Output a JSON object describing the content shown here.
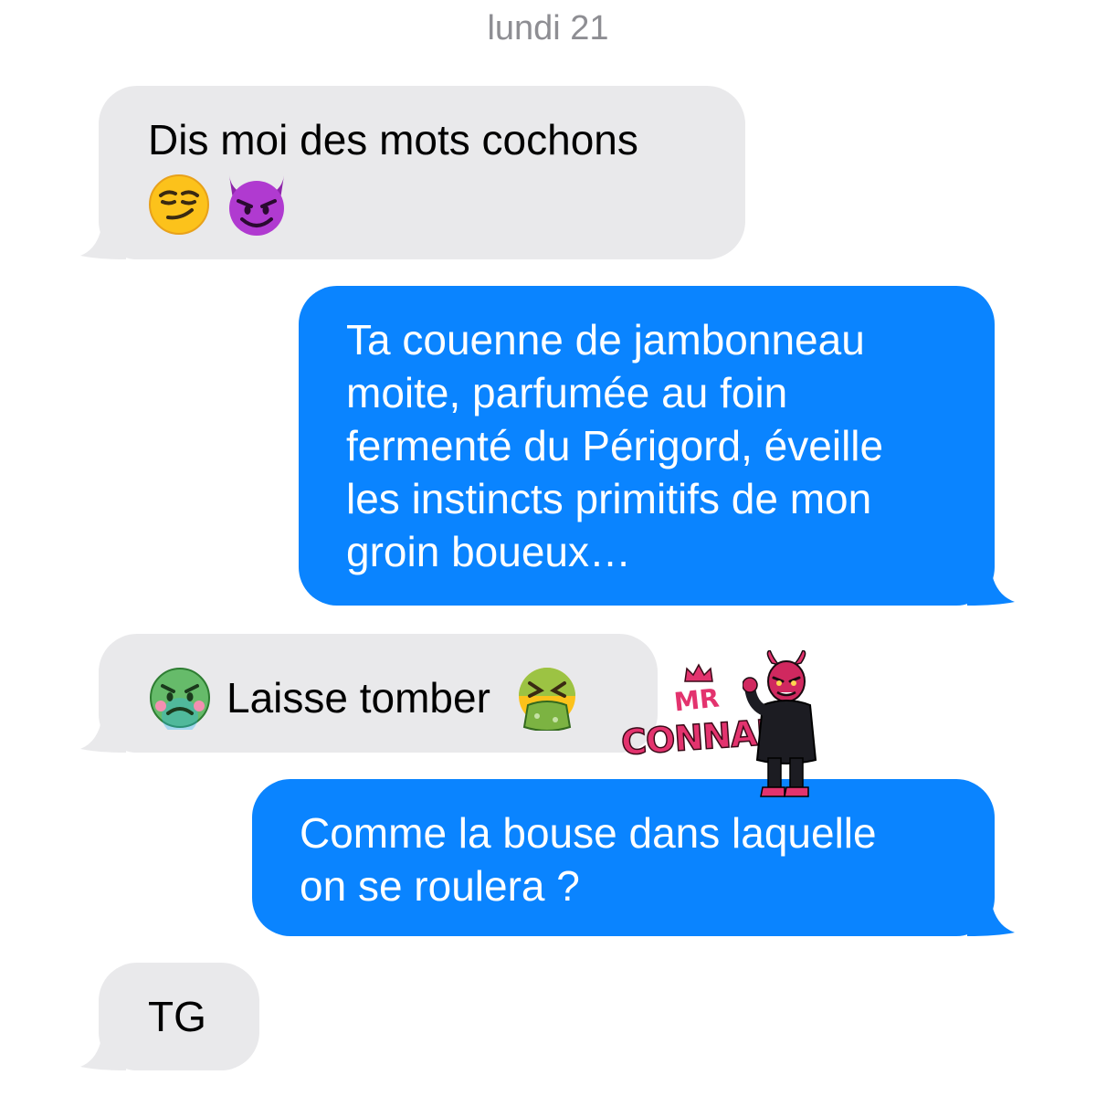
{
  "thread": {
    "date_label": "lundi 21"
  },
  "messages": [
    {
      "id": 1,
      "direction": "incoming",
      "lines": [
        "Dis moi des mots cochons"
      ],
      "emojis": [
        "smirking-face-emoji",
        "smiling-devil-emoji"
      ]
    },
    {
      "id": 2,
      "direction": "outgoing",
      "lines": [
        "Ta couenne de jambonneau",
        "moite, parfumée au foin",
        "fermenté du Périgord, éveille",
        "les instincts primitifs de mon",
        "groin boueux…"
      ]
    },
    {
      "id": 3,
      "direction": "incoming",
      "text": "Laisse tomber",
      "emojis": [
        "nauseated-face-emoji",
        "vomiting-face-emoji"
      ]
    },
    {
      "id": 4,
      "direction": "outgoing",
      "lines": [
        "Comme la bouse dans laquelle",
        "on se roulera ?"
      ]
    },
    {
      "id": 5,
      "direction": "incoming",
      "text": "TG"
    }
  ],
  "sticker": {
    "line1": "MR",
    "line2": "CONNARD",
    "icon": "devil-character-sticker"
  },
  "colors": {
    "incoming_bubble": "#e9e9eb",
    "outgoing_bubble": "#0a84ff",
    "date_text": "#8e8e93",
    "sticker_pink": "#e3336e"
  }
}
